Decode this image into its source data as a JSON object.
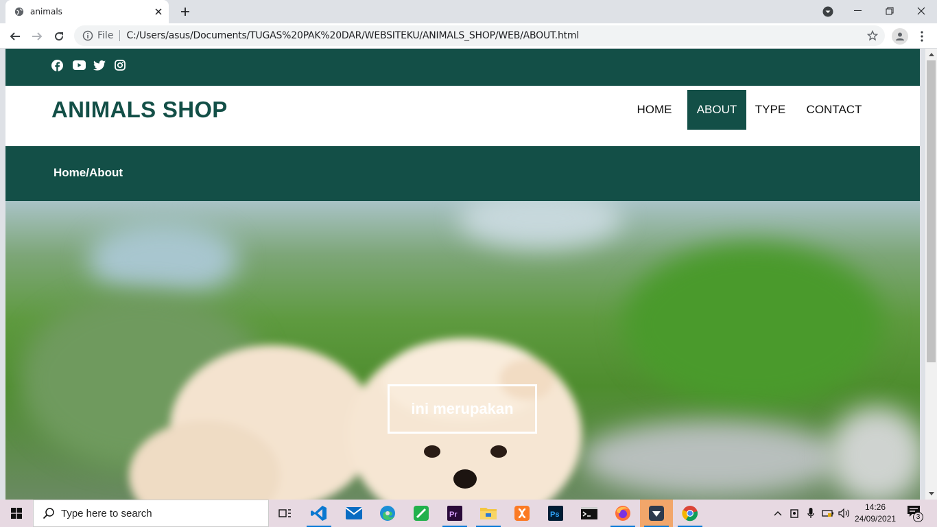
{
  "browser": {
    "tab_title": "animals",
    "scheme_label": "File",
    "url": "C:/Users/asus/Documents/TUGAS%20PAK%20DAR/WEBSITEKU/ANIMALS_SHOP/WEB/ABOUT.html"
  },
  "site": {
    "logo": "ANIMALS SHOP",
    "nav": [
      {
        "label": "HOME",
        "active": false
      },
      {
        "label": "ABOUT",
        "active": true
      },
      {
        "label": "TYPE",
        "active": false
      },
      {
        "label": "CONTACT",
        "active": false
      }
    ],
    "breadcrumb": "Home/About",
    "hero_text": "ini merupakan",
    "brand_color": "#134f47",
    "social_icons": [
      "facebook-icon",
      "youtube-icon",
      "twitter-icon",
      "instagram-icon"
    ]
  },
  "taskbar": {
    "search_placeholder": "Type here to search",
    "time": "14:26",
    "date": "24/09/2021",
    "notification_count": "3"
  }
}
